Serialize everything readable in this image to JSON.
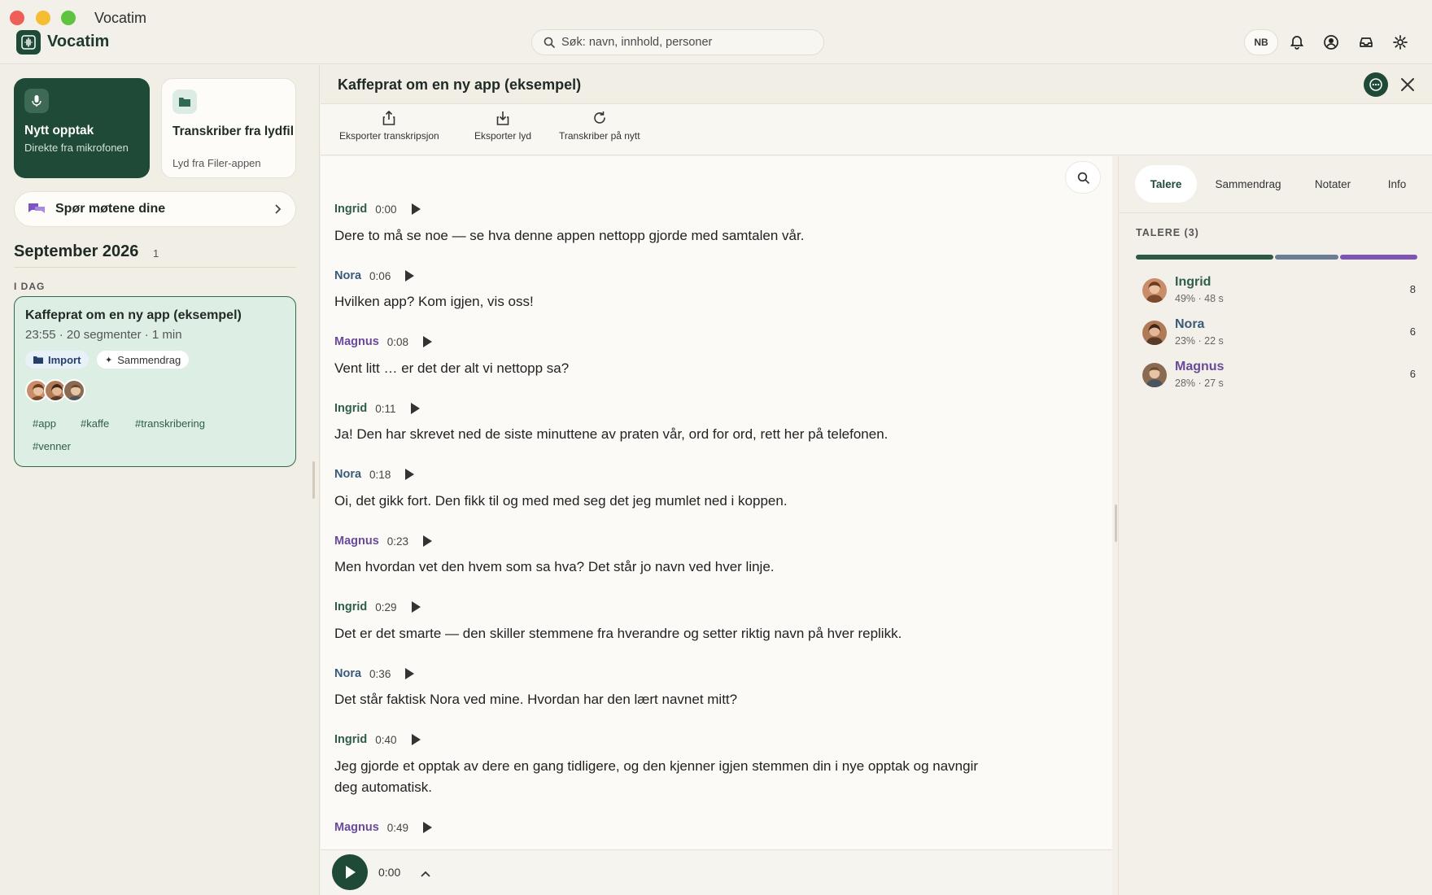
{
  "window": {
    "title": "Vocatim"
  },
  "app": {
    "name": "Vocatim"
  },
  "search": {
    "placeholder": "Søk: navn, innhold, personer"
  },
  "header": {
    "lang_badge": "NB"
  },
  "sidebar": {
    "new_recording": {
      "title": "Nytt opptak",
      "subtitle": "Direkte fra mikrofonen"
    },
    "transcribe_file": {
      "title": "Transkriber fra lydfil",
      "subtitle": "Lyd fra Filer-appen"
    },
    "ask_meetings": "Spør møtene dine",
    "month": "September 2026",
    "month_count": "1",
    "section_today": "I DAG",
    "meeting_card": {
      "title": "Kaffeprat om en ny app (eksempel)",
      "meta": "23:55 · 20 segmenter · 1 min",
      "badge_import": "Import",
      "badge_summary": "Sammendrag",
      "tags": [
        "#app",
        "#kaffe",
        "#transkribering",
        "#venner"
      ]
    }
  },
  "main": {
    "title": "Kaffeprat om en ny app (eksempel)",
    "toolbar": {
      "export_transcript": "Eksporter transkripsjon",
      "export_audio": "Eksporter lyd",
      "retranscribe": "Transkriber på nytt"
    },
    "segments": [
      {
        "speaker": "Ingrid",
        "time": "0:00",
        "text": "Dere to må se noe — se hva denne appen nettopp gjorde med samtalen vår."
      },
      {
        "speaker": "Nora",
        "time": "0:06",
        "text": "Hvilken app? Kom igjen, vis oss!"
      },
      {
        "speaker": "Magnus",
        "time": "0:08",
        "text": "Vent litt … er det der alt vi nettopp sa?"
      },
      {
        "speaker": "Ingrid",
        "time": "0:11",
        "text": "Ja! Den har skrevet ned de siste minuttene av praten vår, ord for ord, rett her på telefonen."
      },
      {
        "speaker": "Nora",
        "time": "0:18",
        "text": "Oi, det gikk fort. Den fikk til og med med seg det jeg mumlet ned i koppen."
      },
      {
        "speaker": "Magnus",
        "time": "0:23",
        "text": "Men hvordan vet den hvem som sa hva? Det står jo navn ved hver linje."
      },
      {
        "speaker": "Ingrid",
        "time": "0:29",
        "text": "Det er det smarte — den skiller stemmene fra hverandre og setter riktig navn på hver replikk."
      },
      {
        "speaker": "Nora",
        "time": "0:36",
        "text": "Det står faktisk Nora ved mine. Hvordan har den lært navnet mitt?"
      },
      {
        "speaker": "Ingrid",
        "time": "0:40",
        "text": "Jeg gjorde et opptak av dere en gang tidligere, og den kjenner igjen stemmen din i nye opptak og navngir deg automatisk."
      },
      {
        "speaker": "Magnus",
        "time": "0:49",
        "text": ""
      }
    ],
    "player_time": "0:00"
  },
  "right_panel": {
    "tabs": [
      "Talere",
      "Sammendrag",
      "Notater",
      "Info"
    ],
    "speakers_label": "TALERE (3)",
    "speakers": [
      {
        "name": "Ingrid",
        "stat": "49% · 48 s",
        "count": "8",
        "share": 0.49
      },
      {
        "name": "Nora",
        "stat": "23% · 22 s",
        "count": "6",
        "share": 0.23
      },
      {
        "name": "Magnus",
        "stat": "28% · 27 s",
        "count": "6",
        "share": 0.28
      }
    ]
  },
  "colors": {
    "brand": "#1e4a37",
    "ingrid": "#2f5e49",
    "nora": "#3a5a7a",
    "magnus": "#6a4a9a",
    "bar_ingrid": "#2c5a45",
    "bar_nora": "#6b7d95",
    "bar_magnus": "#7d55b5"
  }
}
